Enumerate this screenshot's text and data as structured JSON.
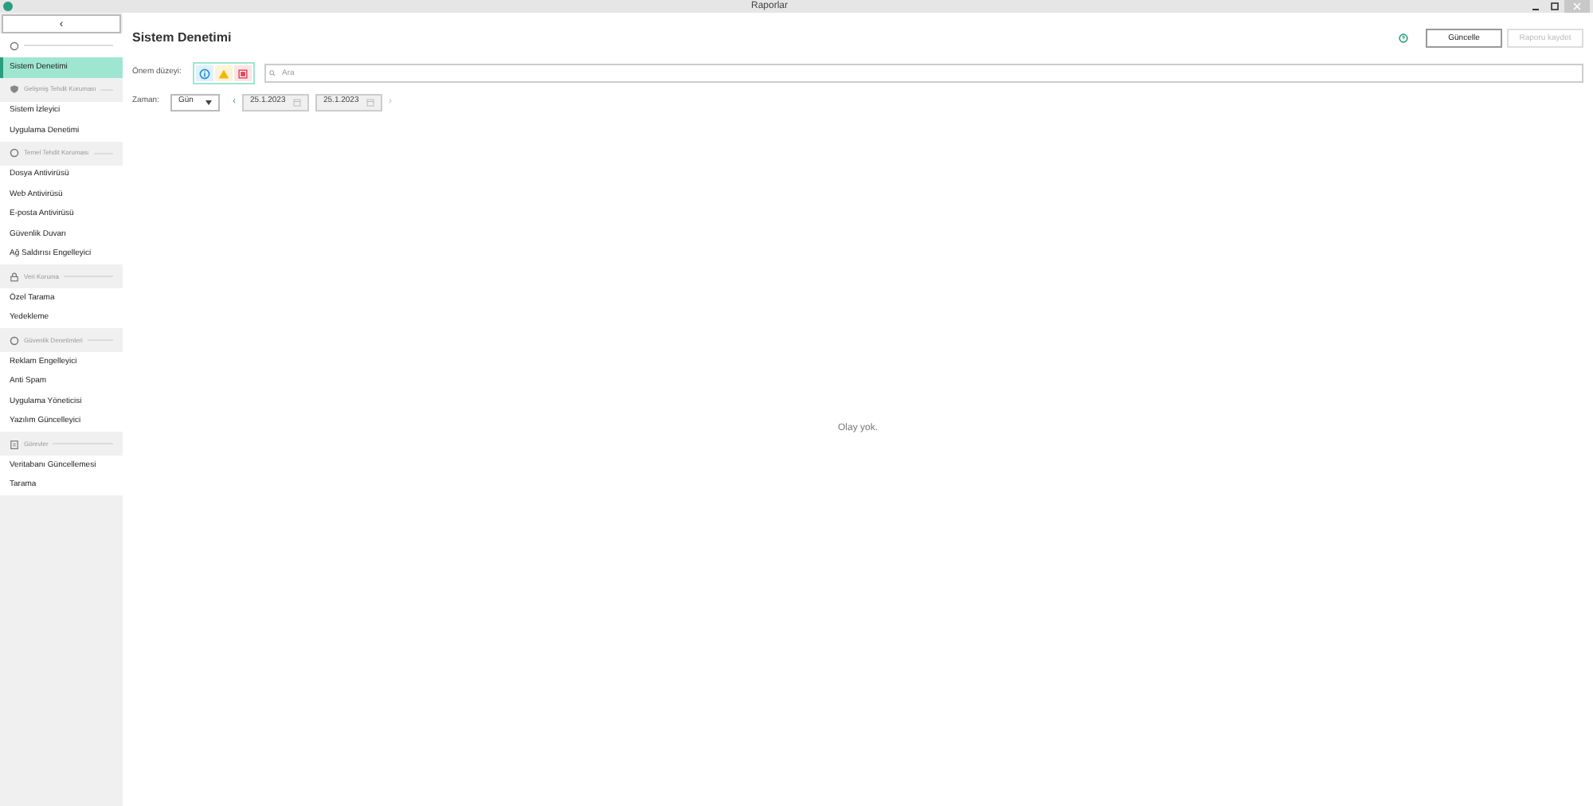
{
  "window": {
    "title": "Raporlar"
  },
  "sidebar": {
    "collapse_button": "‹",
    "groups": [
      {
        "items": [
          {
            "label": "Sistem Denetimi",
            "selected": true
          }
        ]
      },
      {
        "label": "Gelişmiş Tehdit Koruması",
        "kind": "shield",
        "items": [
          {
            "label": "Sistem İzleyici",
            "selected": false
          },
          {
            "label": "Uygulama Denetimi",
            "selected": false
          }
        ]
      },
      {
        "label": "Temel Tehdit Koruması",
        "kind": "circle",
        "items": [
          {
            "label": "Dosya Antivirüsü",
            "selected": false
          },
          {
            "label": "Web Antivirüsü",
            "selected": false
          },
          {
            "label": "E-posta Antivirüsü",
            "selected": false
          },
          {
            "label": "Güvenlik Duvarı",
            "selected": false
          },
          {
            "label": "Ağ Saldırısı Engelleyici",
            "selected": false
          }
        ]
      },
      {
        "label": "Veri Koruma",
        "kind": "lock",
        "items": [
          {
            "label": "Özel Tarama",
            "selected": false
          },
          {
            "label": "Yedekleme",
            "selected": false
          }
        ]
      },
      {
        "label": "Güvenlik Denetimleri",
        "kind": "circle",
        "items": [
          {
            "label": "Reklam Engelleyici",
            "selected": false
          },
          {
            "label": "Anti Spam",
            "selected": false
          },
          {
            "label": "Uygulama Yöneticisi",
            "selected": false
          },
          {
            "label": "Yazılım Güncelleyici",
            "selected": false
          }
        ]
      },
      {
        "label": "Görevler",
        "kind": "clipboard",
        "items": [
          {
            "label": "Veritabanı Güncellemesi",
            "selected": false
          },
          {
            "label": "Tarama",
            "selected": false
          }
        ]
      }
    ]
  },
  "header": {
    "title": "Sistem Denetimi",
    "buttons": [
      {
        "label": "Güncelle",
        "disabled": false
      },
      {
        "label": "Raporu kaydet",
        "disabled": true
      }
    ]
  },
  "filters": {
    "severity_label": "Önem düzeyi:",
    "severity": [
      {
        "kind": "info",
        "selected": true
      },
      {
        "kind": "warning",
        "selected": true
      },
      {
        "kind": "error",
        "selected": true
      }
    ],
    "search": {
      "placeholder": "Ara"
    },
    "time_label": "Zaman:",
    "period": "Gün",
    "prev": "‹",
    "next": "›",
    "next_disabled": true,
    "dates": [
      "25.1.2023",
      "25.1.2023"
    ]
  },
  "empty_message": "Olay yok."
}
